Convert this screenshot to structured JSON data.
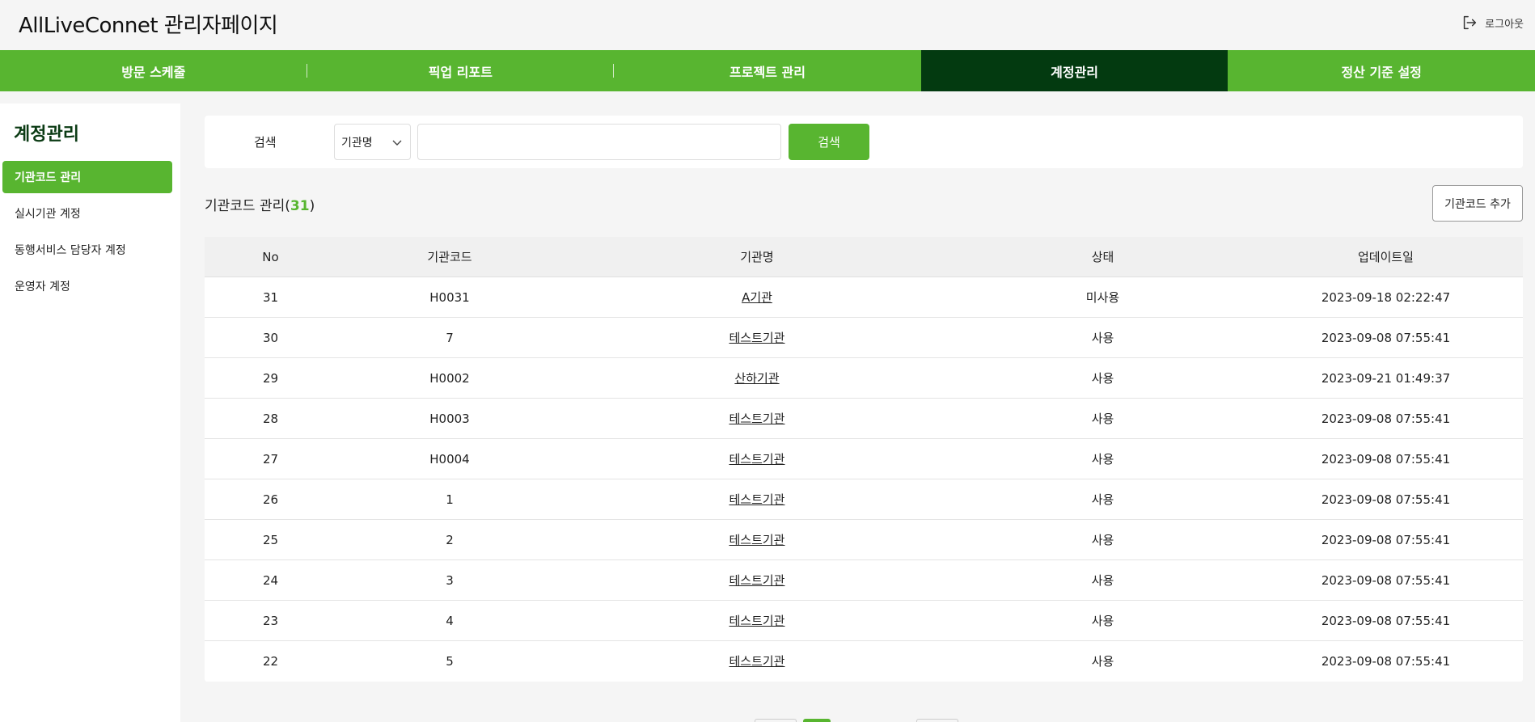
{
  "header": {
    "title": "AllLiveConnet 관리자페이지",
    "logout_label": "로그아웃"
  },
  "nav": {
    "tabs": [
      {
        "label": "방문 스케줄"
      },
      {
        "label": "픽업 리포트"
      },
      {
        "label": "프로젝트 관리"
      },
      {
        "label": "계정관리",
        "active": true
      },
      {
        "label": "정산 기준 설정"
      }
    ]
  },
  "sidebar": {
    "title": "계정관리",
    "items": [
      {
        "label": "기관코드 관리",
        "active": true
      },
      {
        "label": "실시기관 계정"
      },
      {
        "label": "동행서비스 담당자 계정"
      },
      {
        "label": "운영자 계정"
      }
    ]
  },
  "search": {
    "label": "검색",
    "select_value": "기관명",
    "input_value": "",
    "button_label": "검색"
  },
  "list": {
    "title": "기관코드 관리",
    "count": "31",
    "add_button_label": "기관코드 추가"
  },
  "table": {
    "columns": [
      "No",
      "기관코드",
      "기관명",
      "상태",
      "업데이트일"
    ],
    "rows": [
      {
        "no": "31",
        "code": "H0031",
        "name": "A기관",
        "status": "미사용",
        "updated": "2023-09-18 02:22:47"
      },
      {
        "no": "30",
        "code": "7",
        "name": "테스트기관",
        "status": "사용",
        "updated": "2023-09-08 07:55:41"
      },
      {
        "no": "29",
        "code": "H0002",
        "name": "산하기관",
        "status": "사용",
        "updated": "2023-09-21 01:49:37"
      },
      {
        "no": "28",
        "code": "H0003",
        "name": "테스트기관",
        "status": "사용",
        "updated": "2023-09-08 07:55:41"
      },
      {
        "no": "27",
        "code": "H0004",
        "name": "테스트기관",
        "status": "사용",
        "updated": "2023-09-08 07:55:41"
      },
      {
        "no": "26",
        "code": "1",
        "name": "테스트기관",
        "status": "사용",
        "updated": "2023-09-08 07:55:41"
      },
      {
        "no": "25",
        "code": "2",
        "name": "테스트기관",
        "status": "사용",
        "updated": "2023-09-08 07:55:41"
      },
      {
        "no": "24",
        "code": "3",
        "name": "테스트기관",
        "status": "사용",
        "updated": "2023-09-08 07:55:41"
      },
      {
        "no": "23",
        "code": "4",
        "name": "테스트기관",
        "status": "사용",
        "updated": "2023-09-08 07:55:41"
      },
      {
        "no": "22",
        "code": "5",
        "name": "테스트기관",
        "status": "사용",
        "updated": "2023-09-08 07:55:41"
      }
    ]
  },
  "colors": {
    "brand_green": "#58b530",
    "active_tab": "#033a10",
    "sidebar_title": "#0b3b14"
  },
  "icons": {
    "logout": "logout-icon",
    "select": "chevron-down-icon"
  }
}
